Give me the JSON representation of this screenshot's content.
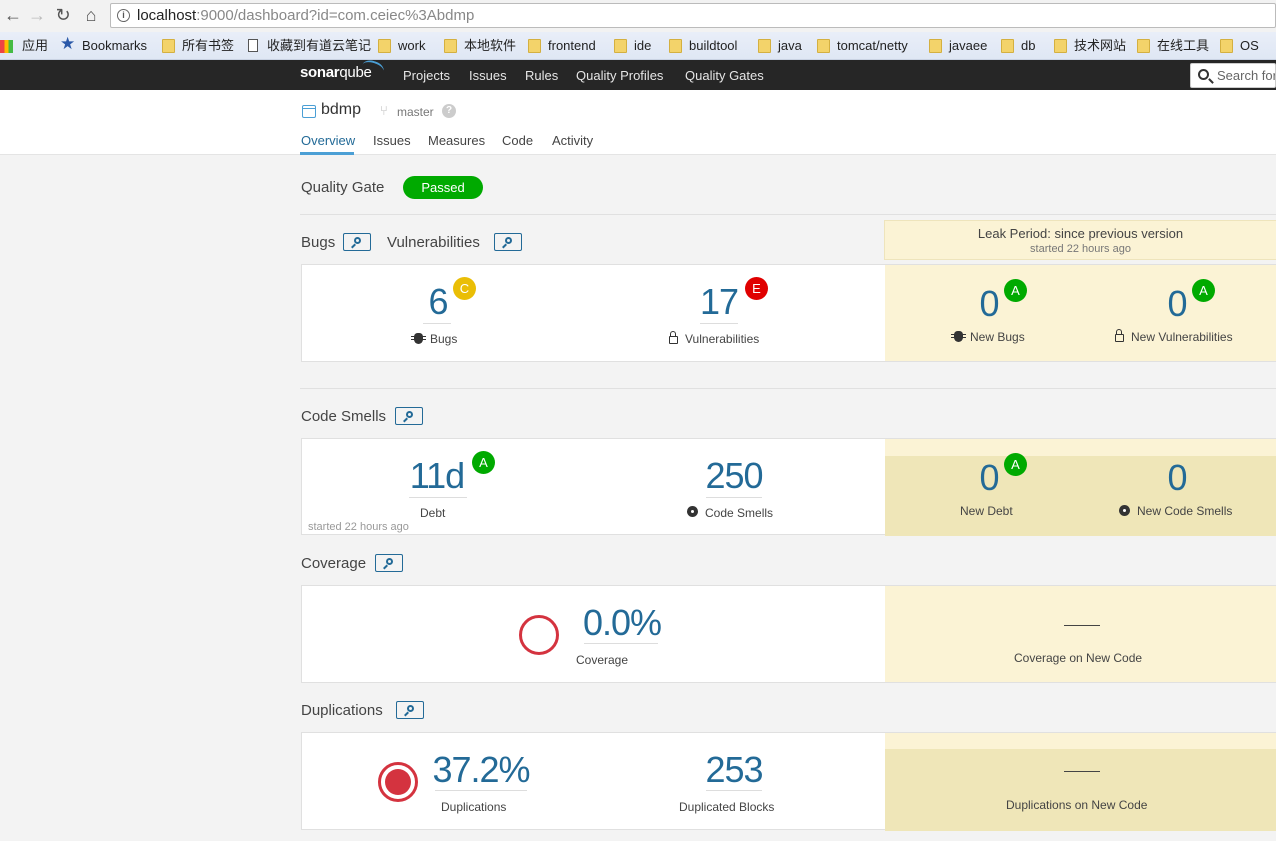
{
  "browser": {
    "url_host": "localhost",
    "url_path": ":9000/dashboard?id=com.ceiec%3Abdmp",
    "bookmarks": [
      "应用",
      "Bookmarks",
      "所有书签",
      "收藏到有道云笔记",
      "work",
      "本地软件",
      "frontend",
      "ide",
      "buildtool",
      "java",
      "tomcat/netty",
      "javaee",
      "db",
      "技术网站",
      "在线工具",
      "OS"
    ]
  },
  "nav": {
    "logo_sonar": "sonar",
    "logo_qube": "qube",
    "links": [
      "Projects",
      "Issues",
      "Rules",
      "Quality Profiles",
      "Quality Gates"
    ],
    "search_placeholder": "Search for"
  },
  "project": {
    "name": "bdmp",
    "branch": "master",
    "help": "?",
    "tabs": [
      "Overview",
      "Issues",
      "Measures",
      "Code",
      "Activity"
    ]
  },
  "quality_gate": {
    "label": "Quality Gate",
    "status": "Passed",
    "status_color": "#00aa00"
  },
  "leak": {
    "title": "Leak Period: since previous version",
    "started": "started 22 hours ago"
  },
  "sections": {
    "bugs_title": "Bugs",
    "vulns_title": "Vulnerabilities",
    "smells_title": "Code Smells",
    "coverage_title": "Coverage",
    "dup_title": "Duplications"
  },
  "bugs": {
    "value": "6",
    "rating": "C",
    "rating_color": "#eabe06",
    "label": "Bugs",
    "new_value": "0",
    "new_rating": "A",
    "new_label": "New Bugs"
  },
  "vulns": {
    "value": "17",
    "rating": "E",
    "rating_color": "#d4333f",
    "label": "Vulnerabilities",
    "new_value": "0",
    "new_rating": "A",
    "new_label": "New Vulnerabilities"
  },
  "debt": {
    "value": "11d",
    "rating": "A",
    "label": "Debt",
    "started": "started 22 hours ago",
    "new_value": "0",
    "new_rating": "A",
    "new_label": "New Debt"
  },
  "smells": {
    "value": "250",
    "label": "Code Smells",
    "new_value": "0",
    "new_label": "New Code Smells"
  },
  "coverage": {
    "value": "0.0%",
    "label": "Coverage",
    "new_label": "Coverage on New Code"
  },
  "duplications": {
    "value": "37.2%",
    "label": "Duplications",
    "blocks_value": "253",
    "blocks_label": "Duplicated Blocks",
    "new_label": "Duplications on New Code"
  },
  "colors": {
    "rating_a": "#00aa00",
    "accent": "#236a97",
    "leak_bg": "#fbf3d5"
  }
}
